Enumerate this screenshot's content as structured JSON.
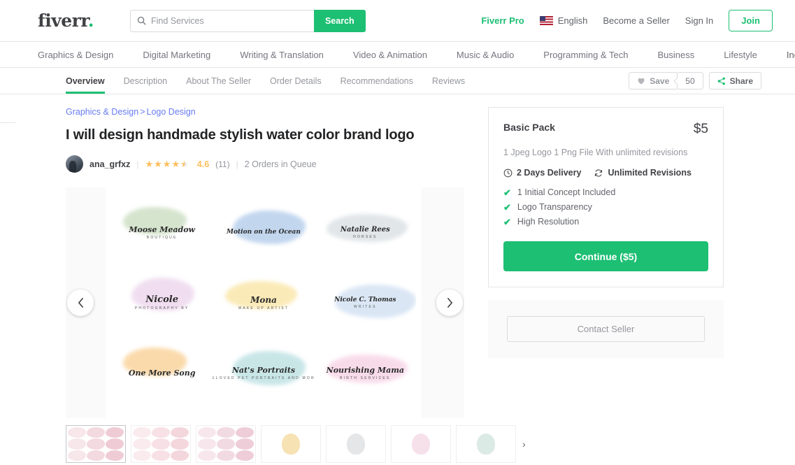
{
  "header": {
    "logo": "fiverr",
    "search": {
      "placeholder": "Find Services",
      "value": "",
      "icon": "search-icon"
    },
    "search_button": "Search",
    "pro_link": "Fiverr Pro",
    "language": "English",
    "language_flag": "us-flag-icon",
    "become_seller": "Become a Seller",
    "sign_in": "Sign In",
    "join": "Join"
  },
  "categories": [
    "Graphics & Design",
    "Digital Marketing",
    "Writing & Translation",
    "Video & Animation",
    "Music & Audio",
    "Programming & Tech",
    "Business",
    "Lifestyle",
    "Industries"
  ],
  "tabs": [
    {
      "label": "Overview",
      "active": true
    },
    {
      "label": "Description",
      "active": false
    },
    {
      "label": "About The Seller",
      "active": false
    },
    {
      "label": "Order Details",
      "active": false
    },
    {
      "label": "Recommendations",
      "active": false
    },
    {
      "label": "Reviews",
      "active": false
    }
  ],
  "tab_actions": {
    "save_label": "Save",
    "save_icon": "heart-icon",
    "save_count": "50",
    "share_label": "Share",
    "share_icon": "share-icon"
  },
  "breadcrumb": {
    "parent": "Graphics & Design",
    "separator": ">",
    "child": "Logo Design"
  },
  "gig": {
    "title": "I will design handmade stylish water color brand logo",
    "seller": "ana_grfxz",
    "avatar": "seller-avatar",
    "rating_value": "4.6",
    "rating_count": "(11)",
    "stars_filled": 4,
    "stars_half": 1,
    "orders_in_queue": "2 Orders in Queue"
  },
  "gallery": {
    "prev_icon": "chevron-left-icon",
    "next_icon": "chevron-right-icon",
    "thumbs_next_icon": "chevron-right-icon",
    "active_thumb_index": 0,
    "logos": [
      {
        "name": "Moose Meadow",
        "sub": "Boutique",
        "accent": "#9cc08a",
        "size": 11
      },
      {
        "name": "Motion on the Ocean",
        "sub": "",
        "accent": "#6f9fd8",
        "size": 9
      },
      {
        "name": "Natalie Rees",
        "sub": "Horses",
        "accent": "#b9c4cc",
        "size": 10
      },
      {
        "name": "Nicole",
        "sub": "Photography by",
        "accent": "#dcb2dd",
        "size": 13
      },
      {
        "name": "Mona",
        "sub": "Make Up Artist",
        "accent": "#f5cf56",
        "size": 12
      },
      {
        "name": "Nicole C. Thomas",
        "sub": "Writes",
        "accent": "#a8c4e6",
        "size": 9
      },
      {
        "name": "One More Song",
        "sub": "",
        "accent": "#f5a93a",
        "size": 11
      },
      {
        "name": "Nat's Portraits",
        "sub": "beloved pet portraits and more",
        "accent": "#7fc4c8",
        "size": 11
      },
      {
        "name": "Nourishing Mama",
        "sub": "Birth Services",
        "accent": "#efaccd",
        "size": 11
      }
    ],
    "thumbnails": [
      {
        "type": "grid",
        "tint": "#e8b7c4"
      },
      {
        "type": "grid",
        "tint": "#f0c5cf"
      },
      {
        "type": "grid",
        "tint": "#e7b9c9"
      },
      {
        "type": "single",
        "tint": "#f0c56a"
      },
      {
        "type": "single",
        "tint": "#c9cdd2"
      },
      {
        "type": "single",
        "tint": "#eec3d8"
      },
      {
        "type": "single",
        "tint": "#b9d6cc"
      }
    ]
  },
  "package": {
    "name": "Basic Pack",
    "price": "$5",
    "description": "1 Jpeg Logo 1 Png File With unlimited revisions",
    "delivery": "2 Days Delivery",
    "delivery_icon": "clock-icon",
    "revisions": "Unlimited Revisions",
    "revisions_icon": "refresh-icon",
    "features": [
      "1 Initial Concept Included",
      "Logo Transparency",
      "High Resolution"
    ],
    "continue_label": "Continue ($5)",
    "contact_label": "Contact Seller"
  },
  "colors": {
    "brand_green": "#1dbf73",
    "link_blue": "#687cf2",
    "star_gold": "#ffbe5b",
    "text_dark": "#404145",
    "text_muted": "#95979d"
  }
}
